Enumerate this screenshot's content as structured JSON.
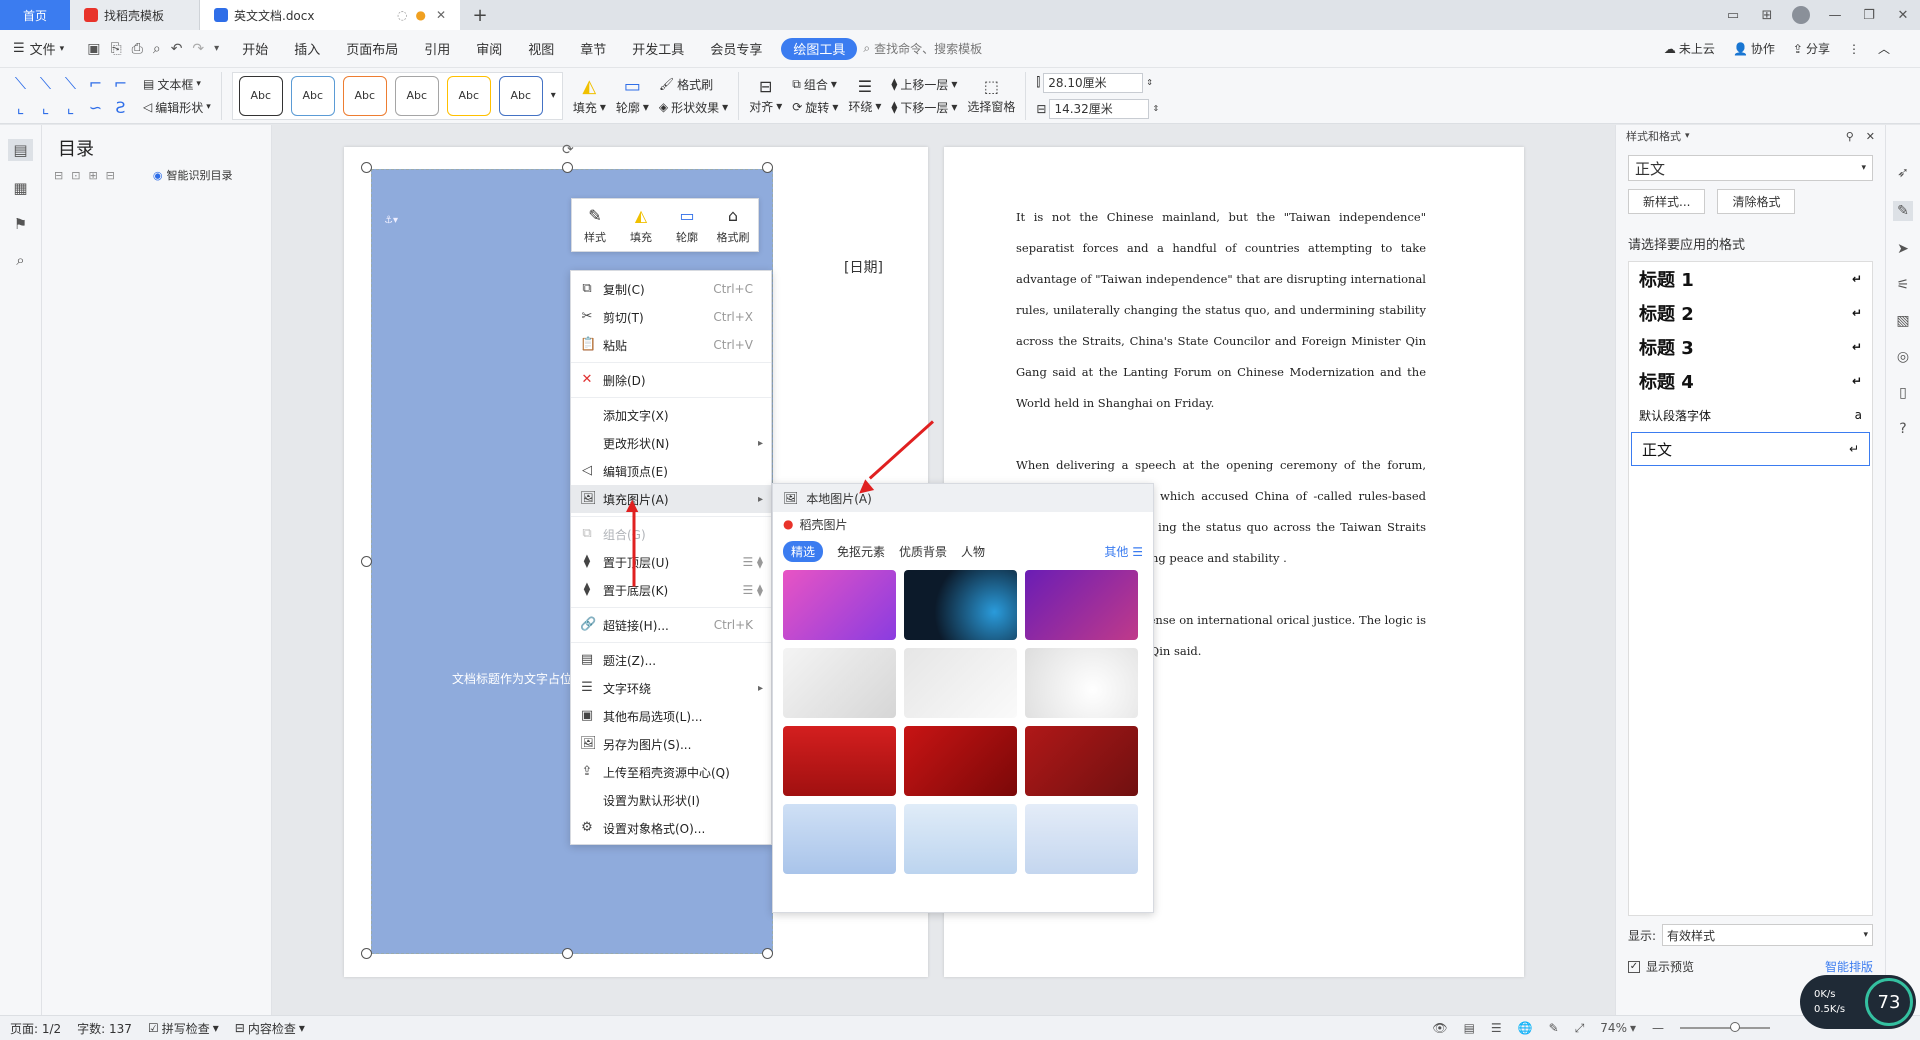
{
  "titlebar": {
    "home_tab": "首页",
    "template_tab": "找稻壳模板",
    "doc_tab": "英文文档.docx",
    "new_tab": "+"
  },
  "menubar": {
    "file": "文件",
    "items": [
      "开始",
      "插入",
      "页面布局",
      "引用",
      "审阅",
      "视图",
      "章节",
      "开发工具",
      "会员专享"
    ],
    "active": "绘图工具",
    "search": "查找命令、搜索模板",
    "cloud": "未上云",
    "collab": "协作",
    "share": "分享"
  },
  "ribbon": {
    "textbox": "文本框",
    "edit_shape": "编辑形状",
    "styles": [
      "Abc",
      "Abc",
      "Abc",
      "Abc",
      "Abc",
      "Abc"
    ],
    "style_colors": [
      "#333333",
      "#5b9bd5",
      "#ed7d31",
      "#a5a5a5",
      "#ffc000",
      "#4472c4"
    ],
    "fill": "填充",
    "outline": "轮廓",
    "format_brush": "格式刷",
    "shape_effect": "形状效果",
    "align": "对齐",
    "group": "组合",
    "rotate": "旋转",
    "wrap": "环绕",
    "bring_forward": "上移一层",
    "send_backward": "下移一层",
    "selection_pane": "选择窗格",
    "width": "28.10厘米",
    "height": "14.32厘米"
  },
  "toc": {
    "title": "目录",
    "smart": "智能识别目录"
  },
  "page1": {
    "date": "[日期]",
    "placeholder": "文档标题作为文字占位"
  },
  "mini_toolbar": {
    "style": "样式",
    "fill": "填充",
    "outline": "轮廓",
    "brush": "格式刷"
  },
  "context_menu": {
    "copy": "复制(C)",
    "copy_sc": "Ctrl+C",
    "cut": "剪切(T)",
    "cut_sc": "Ctrl+X",
    "paste": "粘贴",
    "paste_sc": "Ctrl+V",
    "delete": "删除(D)",
    "add_text": "添加文字(X)",
    "change_shape": "更改形状(N)",
    "edit_points": "编辑顶点(E)",
    "fill_picture": "填充图片(A)",
    "group": "组合(G)",
    "bring_top": "置于顶层(U)",
    "send_bottom": "置于底层(K)",
    "hyperlink": "超链接(H)...",
    "hyperlink_sc": "Ctrl+K",
    "caption": "题注(Z)...",
    "text_wrap": "文字环绕",
    "more_layout": "其他布局选项(L)...",
    "save_as_pic": "另存为图片(S)...",
    "upload": "上传至稻壳资源中心(Q)",
    "set_default": "设置为默认形状(I)",
    "format_object": "设置对象格式(O)..."
  },
  "submenu": {
    "local": "本地图片(A)",
    "docer": "稻壳图片",
    "tabs": [
      "精选",
      "免抠元素",
      "优质背景",
      "人物"
    ],
    "more": "其他"
  },
  "page2": {
    "paragraphs": [
      "It is not the Chinese mainland, but the \"Taiwan independence\" separatist forces and a handful of countries attempting to take advantage of \"Taiwan independence\" that are disrupting international rules, unilaterally changing the status quo, and undermining stability across the Straits, China's State Councilor and Foreign Minister Qin Gang said at the Lanting Forum on Chinese Modernization and the World held in Shanghai on Friday.",
      "When delivering a speech at the opening ceremony of the forum, ecent absurd remarks, which accused China of -called rules-based international order,\" of ing the status quo across the Taiwan Straits ercion,\" and of disrupting peace and stability .",
      "gainst basic common sense on international orical justice. The logic is absurd, and the rous,\" Qin said."
    ]
  },
  "rightpanel": {
    "title": "样式和格式",
    "current": "正文",
    "new_style": "新样式...",
    "clear": "清除格式",
    "prompt": "请选择要应用的格式",
    "styles": [
      "标题 1",
      "标题 2",
      "标题 3",
      "标题 4"
    ],
    "default_font": "默认段落字体",
    "body": "正文",
    "show_label": "显示:",
    "show_value": "有效样式",
    "preview": "显示预览",
    "smart_layout": "智能排版"
  },
  "statusbar": {
    "page": "页面: 1/2",
    "words": "字数: 137",
    "spell": "拼写检查",
    "content": "内容检查",
    "zoom": "74%"
  },
  "speed": {
    "up": "0K/s",
    "down": "0.5K/s",
    "percent": "73"
  }
}
